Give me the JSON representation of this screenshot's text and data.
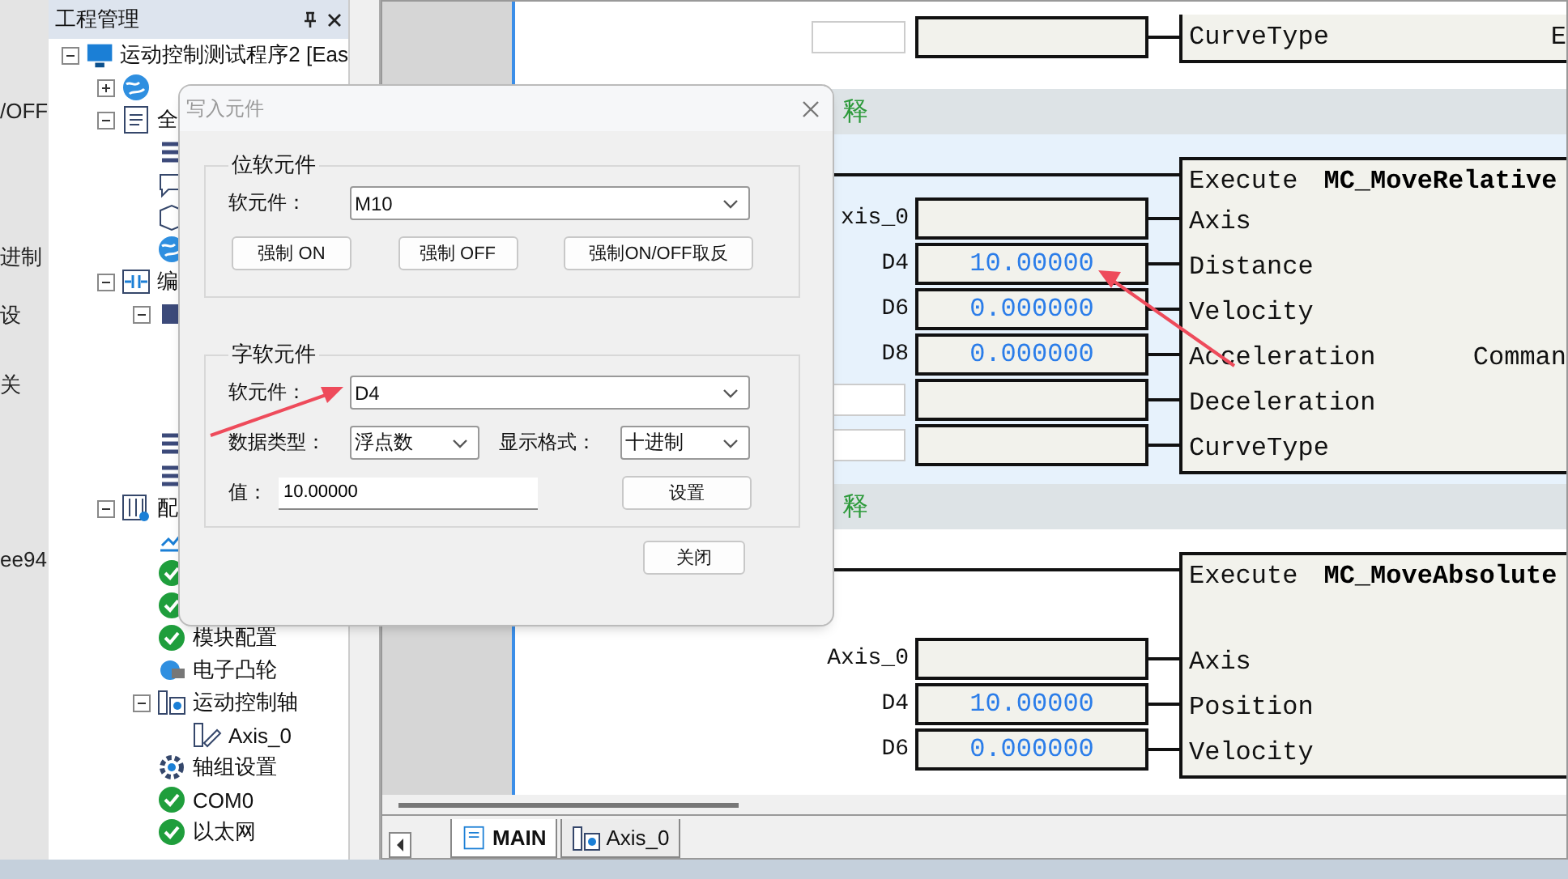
{
  "left_strip": {
    "fragments": [
      "/OFF",
      "进制",
      "设",
      "关",
      "ee94"
    ]
  },
  "project_panel": {
    "title": "工程管理",
    "tree": [
      {
        "label": "运动控制测试程序2 [Eas",
        "kind": "monitor",
        "expanded": true,
        "children": [
          {
            "kind": "globe",
            "expanded": false
          },
          {
            "label": "全",
            "kind": "document",
            "expanded": true,
            "children": [
              {
                "kind": "list"
              },
              {
                "kind": "chat"
              },
              {
                "kind": "box"
              },
              {
                "kind": "globe"
              }
            ]
          },
          {
            "label": "编",
            "kind": "contacts",
            "expanded": true,
            "children": [
              {
                "kind": "block",
                "expanded": true
              },
              {
                "kind": "list"
              },
              {
                "kind": "list"
              }
            ]
          },
          {
            "label": "配",
            "kind": "sliders",
            "expanded": true,
            "children": [
              {
                "kind": "chart"
              },
              {
                "kind": "check"
              },
              {
                "kind": "check"
              },
              {
                "label": "模块配置",
                "kind": "check"
              },
              {
                "label": "电子凸轮",
                "kind": "cam"
              },
              {
                "label": "运动控制轴",
                "kind": "axis",
                "expanded": true,
                "children": [
                  {
                    "label": "Axis_0",
                    "kind": "axisitem"
                  }
                ]
              },
              {
                "label": "轴组设置",
                "kind": "gear"
              },
              {
                "label": "COM0",
                "kind": "check"
              },
              {
                "label": "以太网",
                "kind": "check"
              }
            ]
          }
        ]
      }
    ]
  },
  "editor": {
    "top_row": {
      "pin": "CurveType",
      "output": "E"
    },
    "rungs": [
      {
        "comment": "释",
        "block": {
          "name": "MC_MoveRelative",
          "execute": "Execute",
          "inputs": [
            {
              "var": "xis_0",
              "pin": "Axis"
            },
            {
              "var": "D4",
              "value": "10.00000",
              "pin": "Distance"
            },
            {
              "var": "D6",
              "value": "0.000000",
              "pin": "Velocity"
            },
            {
              "var": "D8",
              "value": "0.000000",
              "pin": "Acceleration",
              "output": "Comman"
            },
            {
              "pin": "Deceleration"
            },
            {
              "pin": "CurveType"
            }
          ]
        }
      },
      {
        "comment": "释",
        "block": {
          "name": "MC_MoveAbsolute",
          "execute": "Execute",
          "inputs": [
            {
              "var": "Axis_0",
              "pin": "Axis"
            },
            {
              "var": "D4",
              "value": "10.00000",
              "pin": "Position"
            },
            {
              "var": "D6",
              "value": "0.000000",
              "pin": "Velocity"
            }
          ]
        }
      }
    ],
    "tabs": [
      {
        "label": "MAIN",
        "kind": "program",
        "selected": true
      },
      {
        "label": "Axis_0",
        "kind": "axis",
        "selected": false
      }
    ]
  },
  "dialog": {
    "title": "写入元件",
    "bit_group": {
      "title": "位软元件",
      "device_label": "软元件：",
      "device": "M10",
      "buttons": [
        "强制 ON",
        "强制 OFF",
        "强制ON/OFF取反"
      ]
    },
    "word_group": {
      "title": "字软元件",
      "device_label": "软元件：",
      "device": "D4",
      "type_label": "数据类型：",
      "type": "浮点数",
      "format_label": "显示格式：",
      "format": "十进制",
      "value_label": "值：",
      "value": "10.00000",
      "set_button": "设置"
    },
    "close_button": "关闭"
  }
}
